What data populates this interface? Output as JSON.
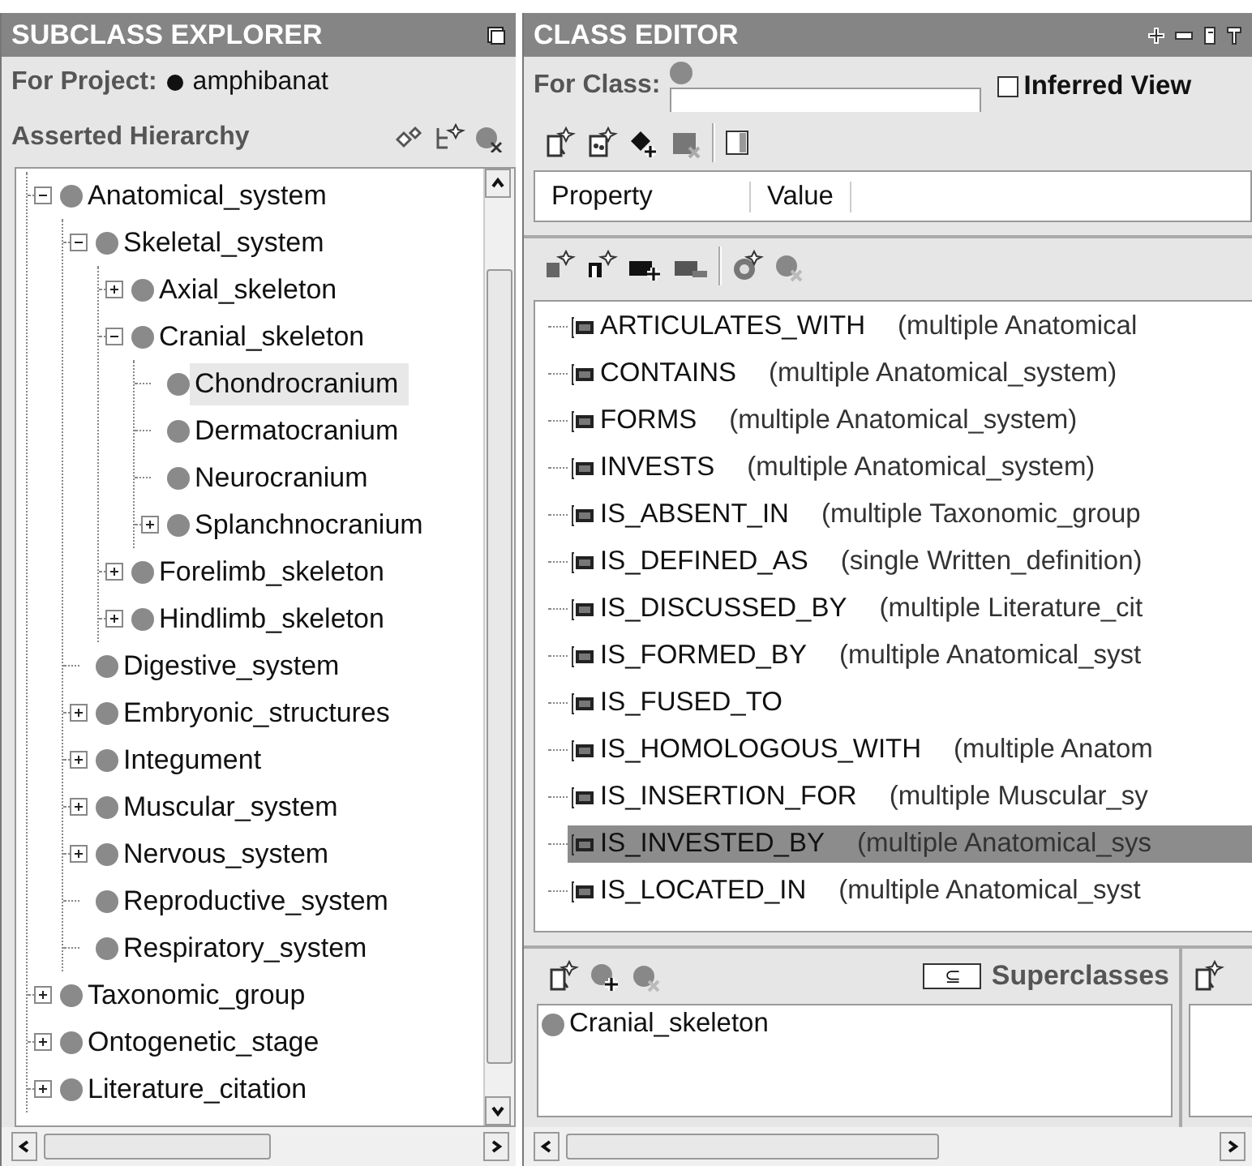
{
  "subclass_explorer": {
    "title": "SUBCLASS EXPLORER",
    "project_label": "For Project:",
    "project_name": "amphibanat",
    "hierarchy_label": "Asserted Hierarchy",
    "tree": [
      {
        "label": "Anatomical_system",
        "expanded": true,
        "selected": false,
        "children": [
          {
            "label": "Skeletal_system",
            "expanded": true,
            "selected": false,
            "children": [
              {
                "label": "Axial_skeleton",
                "expanded": false,
                "selected": false
              },
              {
                "label": "Cranial_skeleton",
                "expanded": true,
                "selected": false,
                "children": [
                  {
                    "label": "Chondrocranium",
                    "selected": true
                  },
                  {
                    "label": "Dermatocranium",
                    "selected": false
                  },
                  {
                    "label": "Neurocranium",
                    "selected": false
                  },
                  {
                    "label": "Splanchnocranium",
                    "expanded": false,
                    "selected": false
                  }
                ]
              },
              {
                "label": "Forelimb_skeleton",
                "expanded": false,
                "selected": false
              },
              {
                "label": "Hindlimb_skeleton",
                "expanded": false,
                "selected": false
              }
            ]
          },
          {
            "label": "Digestive_system",
            "selected": false
          },
          {
            "label": "Embryonic_structures",
            "expanded": false,
            "selected": false
          },
          {
            "label": "Integument",
            "expanded": false,
            "selected": false
          },
          {
            "label": "Muscular_system",
            "expanded": false,
            "selected": false
          },
          {
            "label": "Nervous_system",
            "expanded": false,
            "selected": false
          },
          {
            "label": "Reproductive_system",
            "selected": false
          },
          {
            "label": "Respiratory_system",
            "selected": false
          }
        ]
      },
      {
        "label": "Taxonomic_group",
        "expanded": false,
        "selected": false
      },
      {
        "label": "Ontogenetic_stage",
        "expanded": false,
        "selected": false
      },
      {
        "label": "Literature_citation",
        "expanded": false,
        "selected": false
      }
    ]
  },
  "class_editor": {
    "title": "CLASS EDITOR",
    "for_class_label": "For Class:",
    "inferred_view": {
      "label": "Inferred View",
      "checked": false
    },
    "table_columns": [
      "Property",
      "Value"
    ],
    "properties": [
      {
        "name": "ARTICULATES_WITH",
        "range": "(multiple Anatomical",
        "selected": false
      },
      {
        "name": "CONTAINS",
        "range": "(multiple Anatomical_system)",
        "selected": false
      },
      {
        "name": "FORMS",
        "range": "(multiple Anatomical_system)",
        "selected": false
      },
      {
        "name": "INVESTS",
        "range": "(multiple Anatomical_system)",
        "selected": false
      },
      {
        "name": "IS_ABSENT_IN",
        "range": "(multiple Taxonomic_group",
        "selected": false
      },
      {
        "name": "IS_DEFINED_AS",
        "range": "(single Written_definition)",
        "selected": false
      },
      {
        "name": "IS_DISCUSSED_BY",
        "range": "(multiple Literature_cit",
        "selected": false
      },
      {
        "name": "IS_FORMED_BY",
        "range": "(multiple Anatomical_syst",
        "selected": false
      },
      {
        "name": "IS_FUSED_TO",
        "selected": false
      },
      {
        "name": "IS_HOMOLOGOUS_WITH",
        "range": "(multiple Anatom",
        "selected": false
      },
      {
        "name": "IS_INSERTION_FOR",
        "range": "(multiple Muscular_sy",
        "selected": false
      },
      {
        "name": "IS_INVESTED_BY",
        "range": "(multiple Anatomical_sys",
        "selected": true
      },
      {
        "name": "IS_LOCATED_IN",
        "range": "(multiple Anatomical_syst",
        "selected": false
      }
    ],
    "superclasses": {
      "symbol": "⊆",
      "label": "Superclasses",
      "items": [
        "Cranial_skeleton"
      ]
    }
  }
}
